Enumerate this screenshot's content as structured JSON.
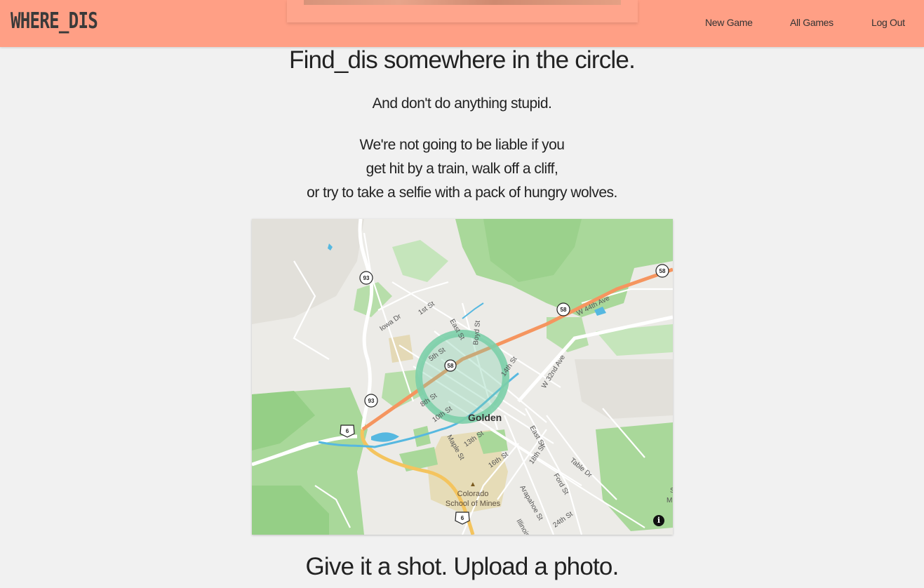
{
  "header": {
    "logo": "WHERE_DIS",
    "nav": {
      "new_game": "New Game",
      "all_games": "All Games",
      "log_out": "Log Out"
    },
    "color": "#ff9f85"
  },
  "main": {
    "title": "Find_dis somewhere in the circle.",
    "subtitle": "And don't do anything stupid.",
    "disclaimer": [
      "We're not going to be liable if you",
      "get hit by a train, walk off a cliff,",
      "or try to take a selfie with a pack of hungry wolves."
    ],
    "upload_prompt": "Give it a shot. Upload a photo."
  },
  "map": {
    "labels": {
      "city": "Golden",
      "campus_line1": "Colorado",
      "campus_line2": "School of Mines",
      "w44": "W 44th Ave",
      "w32": "W 32nd Ave",
      "iowa": "Iowa Dr",
      "first": "1st St",
      "fifth": "5th St",
      "east": "East St",
      "boyd": "Boyd St",
      "tenth_partial": "10th St",
      "eighth_partial": "8th St",
      "maple": "Maple St",
      "thirteenth": "13th St",
      "sixteenth": "16th St",
      "eighteenth": "18th St",
      "east_lower": "East St",
      "ford": "Ford St",
      "table": "Table Dr",
      "arapahoe": "Arapahoe St",
      "twentyfourth": "24th St",
      "illinois": "Illinois",
      "fourteenth_partial": "14th St",
      "edge_s": "S",
      "edge_m": "M"
    },
    "shields": {
      "h93": "93",
      "h58": "58",
      "us6": "6"
    },
    "info_icon": "i",
    "circle_color": "#7ccfa8",
    "highway_color": "#f5955f"
  }
}
